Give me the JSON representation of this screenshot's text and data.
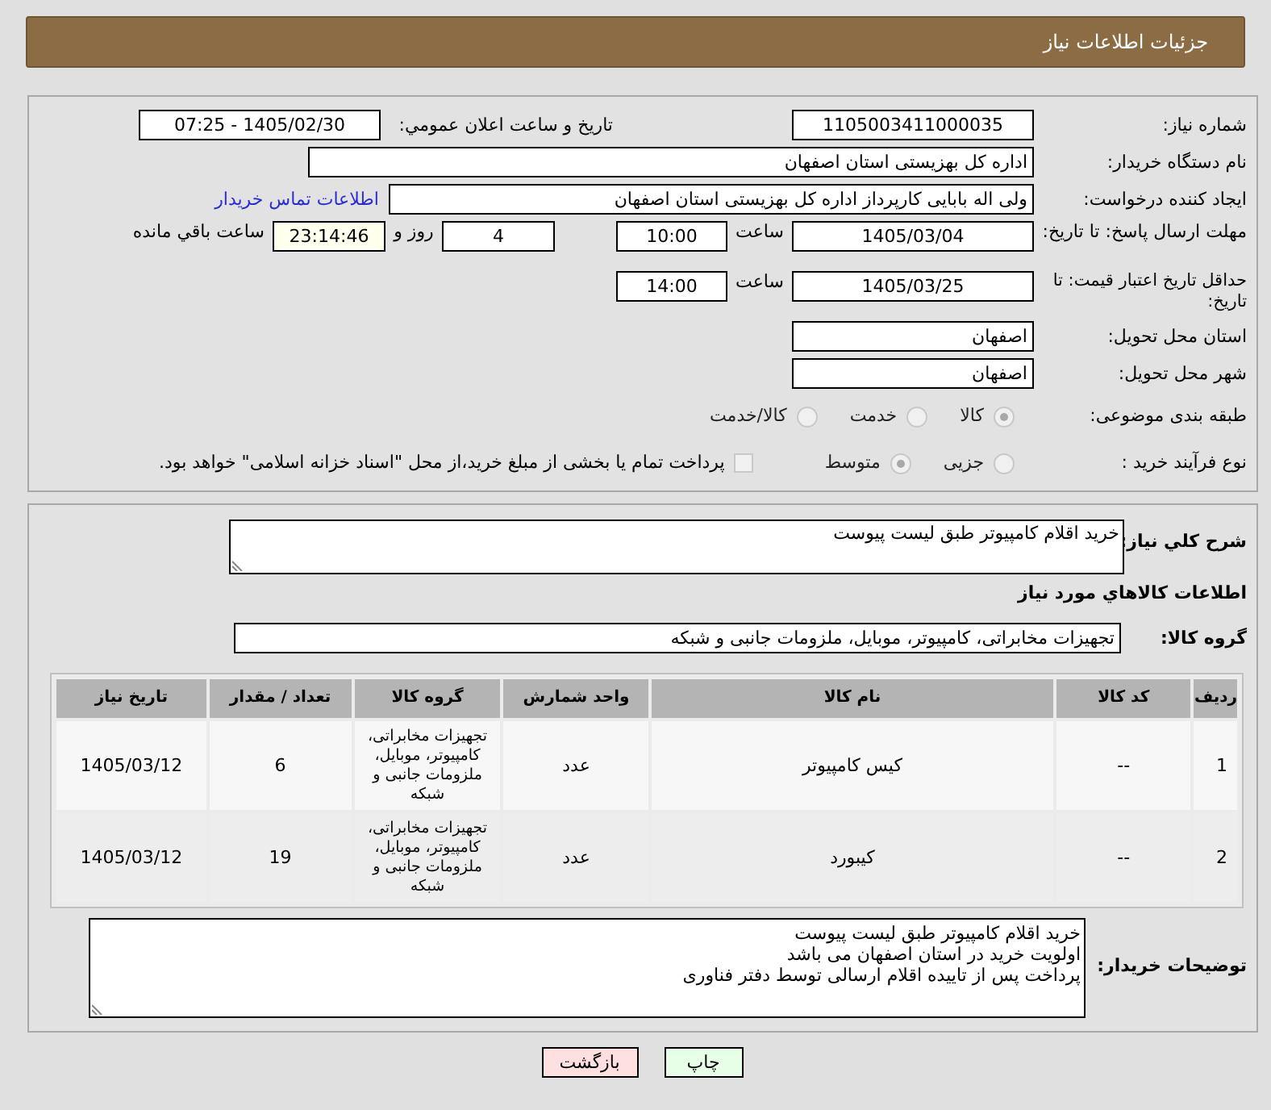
{
  "header_title": "جزئیات اطلاعات نیاز",
  "need_number": {
    "label": "شماره نیاز:",
    "value": "1105003411000035"
  },
  "announce": {
    "label": "تاریخ و ساعت اعلان عمومي:",
    "value": "1405/02/30 - 07:25"
  },
  "buyer_org": {
    "label": "نام دستگاه خریدار:",
    "value": "اداره کل بهزیستی استان اصفهان"
  },
  "requester": {
    "label": "ایجاد کننده درخواست:",
    "value": "ولی اله بابایی کارپرداز اداره کل بهزیستی استان اصفهان",
    "link": "اطلاعات تماس خریدار"
  },
  "deadline": {
    "label": "مهلت ارسال پاسخ: تا تاریخ:",
    "date": "1405/03/04",
    "time_label": "ساعت",
    "time": "10:00",
    "days": "4",
    "days_label": "روز و",
    "remaining": "23:14:46",
    "remaining_label": "ساعت باقي مانده"
  },
  "validity": {
    "label": "حداقل تاریخ اعتبار قیمت: تا تاریخ:",
    "date": "1405/03/25",
    "time_label": "ساعت",
    "time": "14:00"
  },
  "province": {
    "label": "استان محل تحویل:",
    "value": "اصفهان"
  },
  "city": {
    "label": "شهر محل تحویل:",
    "value": "اصفهان"
  },
  "category": {
    "label": "طبقه بندی موضوعی:",
    "options": [
      {
        "label": "کالا",
        "selected": true
      },
      {
        "label": "خدمت",
        "selected": false
      },
      {
        "label": "کالا/خدمت",
        "selected": false
      }
    ]
  },
  "process": {
    "label": "نوع فرآیند خرید :",
    "options": [
      {
        "label": "جزیی",
        "selected": false
      },
      {
        "label": "متوسط",
        "selected": true
      }
    ],
    "treasury": {
      "label": "پرداخت تمام یا بخشی از مبلغ خرید،از محل \"اسناد خزانه اسلامی\" خواهد بود.",
      "checked": false
    }
  },
  "description": {
    "label": "شرح کلي نیاز:",
    "value": "خرید اقلام کامپیوتر طبق لیست پیوست"
  },
  "goods_title": "اطلاعات کالاهاي مورد نیاز",
  "goods_group": {
    "label": "گروه کالا:",
    "value": "تجهیزات مخابراتی، کامپیوتر، موبایل، ملزومات جانبی و شبکه"
  },
  "table": {
    "columns": [
      "ردیف",
      "کد کالا",
      "نام کالا",
      "واحد شمارش",
      "گروه کالا",
      "تعداد / مقدار",
      "تاریخ نیاز"
    ],
    "rows": [
      [
        "1",
        "--",
        "کیس کامپیوتر",
        "عدد",
        "تجهیزات مخابراتی، کامپیوتر، موبایل، ملزومات جانبی و شبکه",
        "6",
        "1405/03/12"
      ],
      [
        "2",
        "--",
        "کیبورد",
        "عدد",
        "تجهیزات مخابراتی، کامپیوتر، موبایل، ملزومات جانبی و شبکه",
        "19",
        "1405/03/12"
      ]
    ]
  },
  "buyer_notes": {
    "label": "توضیحات خریدار:",
    "value": "خرید اقلام کامپیوتر طبق لیست پیوست\nاولویت خرید در استان اصفهان می باشد\nپرداخت پس از تایيده اقلام ارسالی توسط دفتر فناوری"
  },
  "buttons": [
    {
      "kind": "print",
      "label": "چاپ"
    },
    {
      "kind": "back",
      "label": "بازگشت"
    }
  ]
}
